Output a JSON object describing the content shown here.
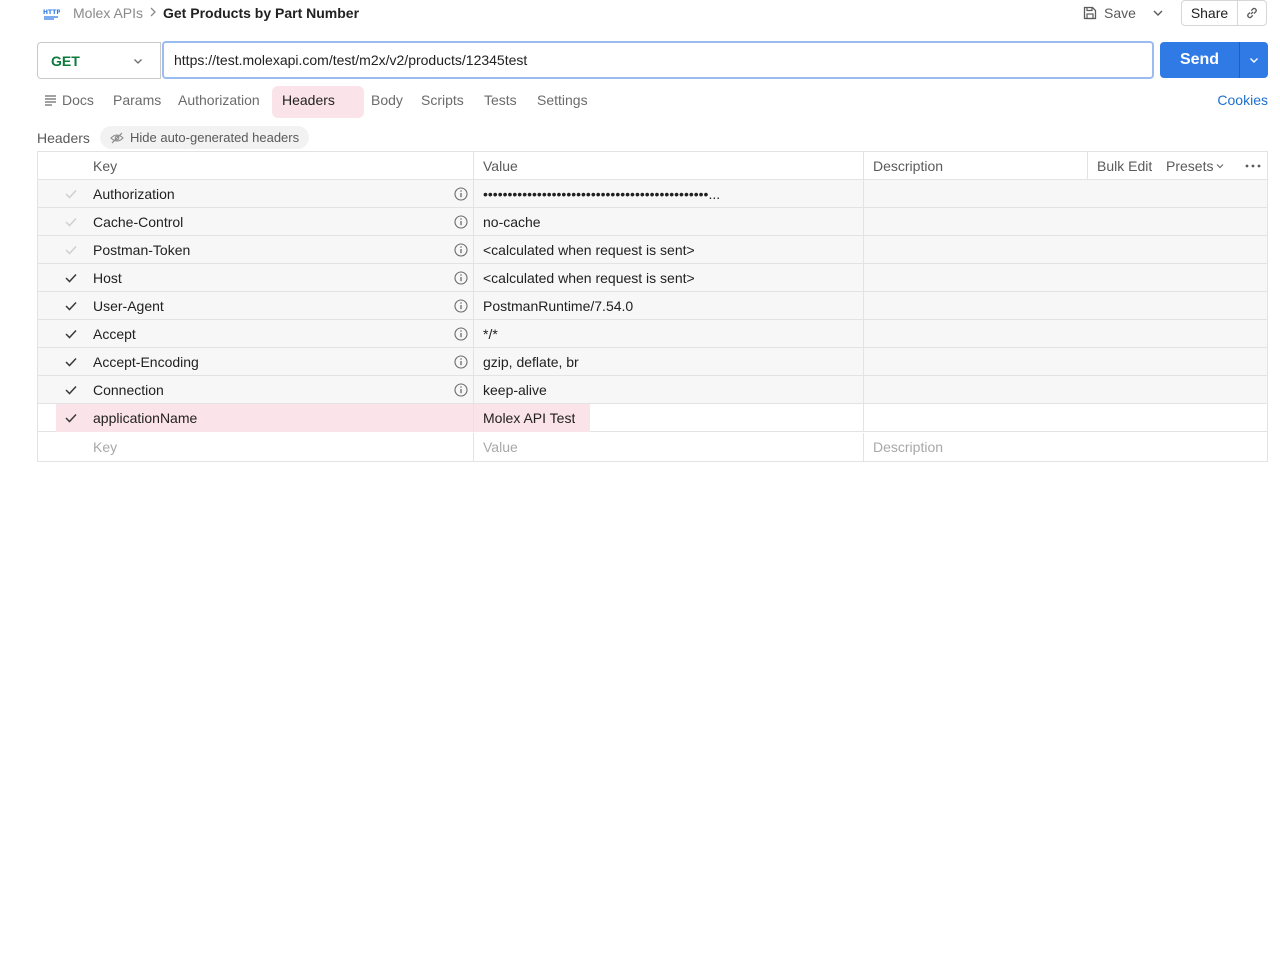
{
  "breadcrumb": {
    "parent": "Molex APIs",
    "current": "Get Products by Part Number"
  },
  "toolbar": {
    "save_label": "Save",
    "share_label": "Share"
  },
  "request": {
    "method": "GET",
    "url": "https://test.molexapi.com/test/m2x/v2/products/12345test",
    "send_label": "Send"
  },
  "tabs": {
    "docs": "Docs",
    "params": "Params",
    "authorization": "Authorization",
    "headers": "Headers",
    "body": "Body",
    "scripts": "Scripts",
    "tests": "Tests",
    "settings": "Settings",
    "cookies": "Cookies"
  },
  "headers_section": {
    "label": "Headers",
    "hide_auto_label": "Hide auto-generated headers"
  },
  "table": {
    "columns": {
      "key": "Key",
      "value": "Value",
      "description": "Description",
      "bulk_edit": "Bulk Edit",
      "presets": "Presets"
    },
    "rows": [
      {
        "key": "Authorization",
        "value": "••••••••••••••••••••••••••••••••••••••••••••••..."
      },
      {
        "key": "Cache-Control",
        "value": "no-cache"
      },
      {
        "key": "Postman-Token",
        "value": "<calculated when request is sent>"
      },
      {
        "key": "Host",
        "value": "<calculated when request is sent>"
      },
      {
        "key": "User-Agent",
        "value": "PostmanRuntime/7.54.0"
      },
      {
        "key": "Accept",
        "value": "*/*"
      },
      {
        "key": "Accept-Encoding",
        "value": "gzip, deflate, br"
      },
      {
        "key": "Connection",
        "value": "keep-alive"
      },
      {
        "key": "applicationName",
        "value": "Molex API Test"
      }
    ],
    "placeholders": {
      "key": "Key",
      "value": "Value",
      "description": "Description"
    }
  },
  "colors": {
    "accent": "#2f7ae5",
    "method_get": "#0b7a3a",
    "highlight": "#fbe3ea",
    "link": "#1f6fcf"
  }
}
